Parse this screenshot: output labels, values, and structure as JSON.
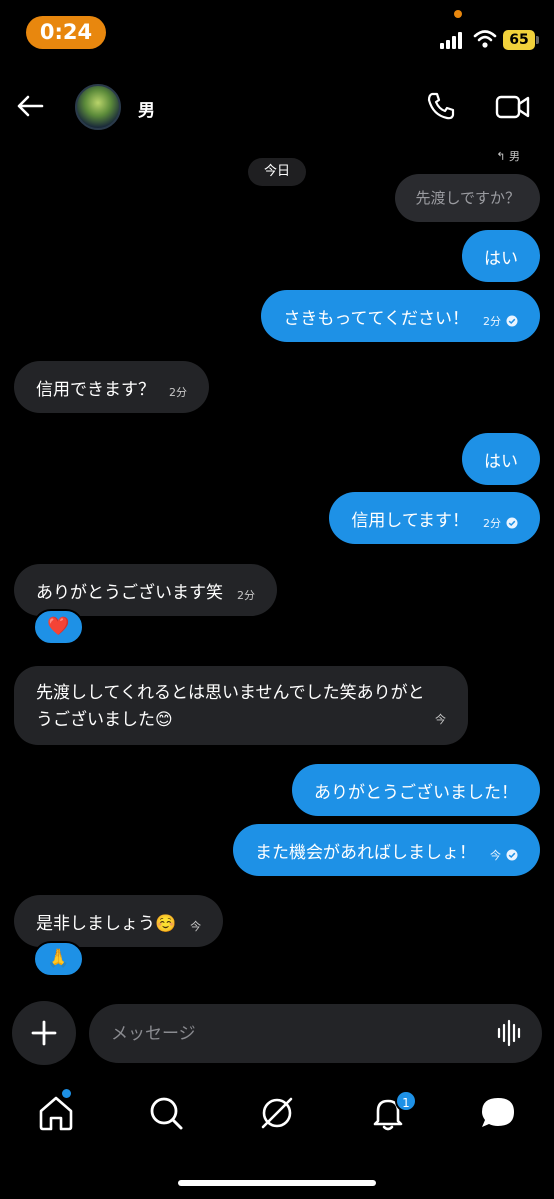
{
  "status": {
    "time": "0:24",
    "battery": "65"
  },
  "header": {
    "contact_name": "男"
  },
  "thread": {
    "day_label": "今日",
    "reply_to": "↰ 男",
    "quoted": "先渡しですか？",
    "messages": [
      {
        "dir": "sent",
        "text": "はい",
        "time": ""
      },
      {
        "dir": "sent",
        "text": "さきもっててください！",
        "time": "2分"
      },
      {
        "dir": "recv",
        "text": "信用できます？",
        "time": "2分"
      },
      {
        "dir": "sent",
        "text": "はい",
        "time": ""
      },
      {
        "dir": "sent",
        "text": "信用してます！",
        "time": "2分"
      },
      {
        "dir": "recv",
        "text": "ありがとうございます笑",
        "time": "2分",
        "reaction": "❤️"
      },
      {
        "dir": "recv",
        "line1": "先渡ししてくれるとは思いませんでした笑ありがと",
        "line2": "うございました😊",
        "time": "今"
      },
      {
        "dir": "sent",
        "text": "ありがとうございました！",
        "time": ""
      },
      {
        "dir": "sent",
        "text": "また機会があればしましょ！",
        "time": "今"
      },
      {
        "dir": "recv",
        "text": "是非しましょう☺️",
        "time": "今",
        "reaction": "🙏"
      }
    ]
  },
  "composer": {
    "placeholder": "メッセージ"
  },
  "tabbar": {
    "notifications_badge": "1"
  },
  "colors": {
    "accent": "#1e91e6",
    "status_pill": "#e8870e",
    "received_bubble": "#232427"
  }
}
